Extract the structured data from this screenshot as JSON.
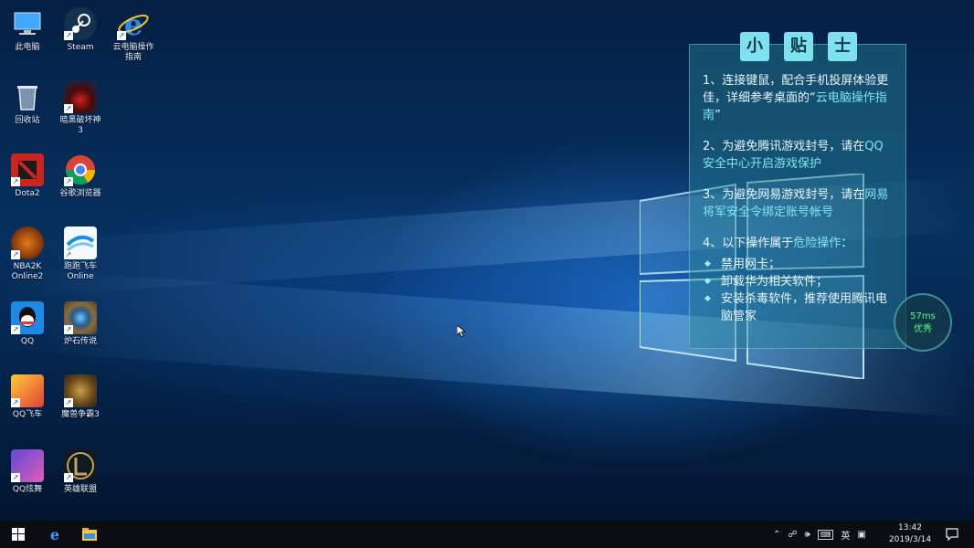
{
  "desktop_icons": [
    {
      "label": "此电脑",
      "icon": "computer-icon"
    },
    {
      "label": "Steam",
      "icon": "steam-icon"
    },
    {
      "label": "云电脑操作\n指南",
      "icon": "ie-icon"
    },
    {
      "label": "回收站",
      "icon": "recycle-bin-icon"
    },
    {
      "label": "暗黑破坏神\n3",
      "icon": "diablo-icon"
    },
    {
      "label": "Dota2",
      "icon": "dota2-icon"
    },
    {
      "label": "谷歌浏览器",
      "icon": "chrome-icon"
    },
    {
      "label": "NBA2K\nOnline2",
      "icon": "nba2k-icon"
    },
    {
      "label": "跑跑飞车\nOnline",
      "icon": "speed-online-icon"
    },
    {
      "label": "QQ",
      "icon": "qq-icon"
    },
    {
      "label": "炉石传说",
      "icon": "hearthstone-icon"
    },
    {
      "label": "QQ飞车",
      "icon": "qq-speed-icon"
    },
    {
      "label": "魔兽争霸3",
      "icon": "warcraft3-icon"
    },
    {
      "label": "QQ炫舞",
      "icon": "qq-dance-icon"
    },
    {
      "label": "英雄联盟",
      "icon": "lol-icon"
    }
  ],
  "tips": {
    "title_chars": [
      "小",
      "贴",
      "士"
    ],
    "p1_a": "1、连接键鼠，配合手机投屏体验更佳，详细参考桌面的“",
    "p1_hl": "云电脑操作指南",
    "p1_b": "”",
    "p2_a": "2、为避免腾讯游戏封号，请在",
    "p2_hl": "QQ 安全中心开启游戏保护",
    "p3_a": "3、为避免网易游戏封号，请在",
    "p3_hl": "网易将军安全令绑定账号帐号",
    "p4_a": "4、以下操作属于",
    "p4_hl": "危险操作",
    "p4_b": "：",
    "bullets": [
      "禁用网卡；",
      "卸载华为相关软件；",
      "安装杀毒软件，推荐使用腾讯电脑管家"
    ]
  },
  "speed": {
    "value": "57ms",
    "status": "优秀"
  },
  "taskbar": {
    "tray_icons": [
      "chevron-up-icon",
      "network-icon",
      "volume-icon",
      "input-mode-icon",
      "ime-icon",
      "notification-icon"
    ],
    "input_label": "英",
    "time": "13:42",
    "date": "2019/3/14"
  },
  "colors": {
    "accent": "#7fe1ee",
    "highlight": "#7fe6f2",
    "speed_good": "#55ff88"
  }
}
